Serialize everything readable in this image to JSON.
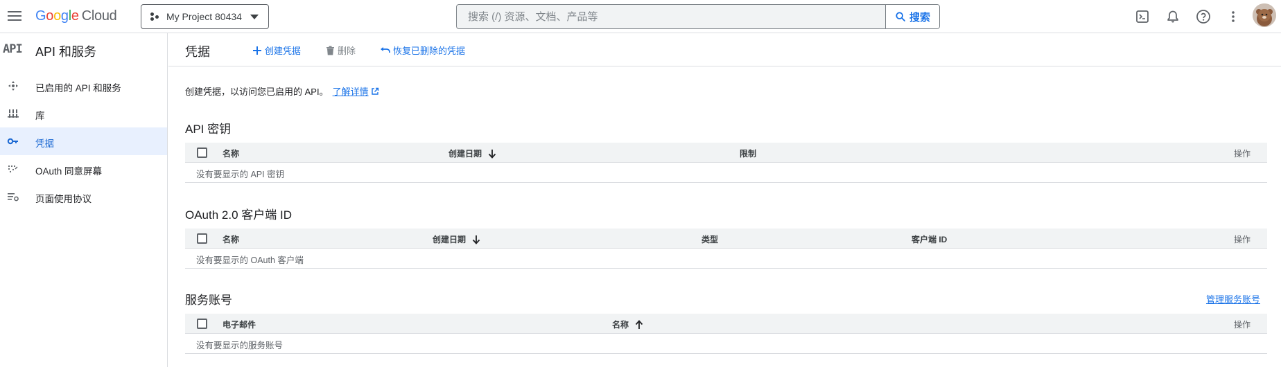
{
  "topbar": {
    "logo": {
      "g": "G",
      "o1": "o",
      "o2": "o",
      "g2": "g",
      "l": "l",
      "e": "e",
      "cloud": "Cloud"
    },
    "project_name": "My Project 80434",
    "search_placeholder": "搜索 (/) 资源、文档、产品等",
    "search_button": "搜索",
    "icons": [
      "terminal-icon",
      "bell-icon",
      "help-icon",
      "more-vert-icon",
      "avatar"
    ]
  },
  "sidebar": {
    "logo_text": "API",
    "title": "API 和服务",
    "items": [
      {
        "label": "已启用的 API 和服务",
        "icon": "enabled-apis-icon",
        "active": false
      },
      {
        "label": "库",
        "icon": "library-icon",
        "active": false
      },
      {
        "label": "凭据",
        "icon": "key-icon",
        "active": true
      },
      {
        "label": "OAuth 同意屏幕",
        "icon": "oauth-consent-icon",
        "active": false
      },
      {
        "label": "页面使用协议",
        "icon": "page-agreements-icon",
        "active": false
      }
    ]
  },
  "main": {
    "title": "凭据",
    "actions": {
      "create": "创建凭据",
      "delete": "删除",
      "restore": "恢复已删除的凭据"
    },
    "intro": {
      "text": "创建凭据，以访问您已启用的 API。",
      "link": "了解详情"
    },
    "api_keys": {
      "title": "API 密钥",
      "columns": [
        "名称",
        "创建日期",
        "限制",
        "操作"
      ],
      "empty": "没有要显示的 API 密钥"
    },
    "oauth": {
      "title": "OAuth 2.0 客户端 ID",
      "columns": [
        "名称",
        "创建日期",
        "类型",
        "客户端 ID",
        "操作"
      ],
      "empty": "没有要显示的 OAuth 客户端"
    },
    "service_accounts": {
      "title": "服务账号",
      "manage_link": "管理服务账号",
      "columns": [
        "电子邮件",
        "名称",
        "操作"
      ],
      "empty": "没有要显示的服务账号"
    }
  },
  "colors": {
    "accent": "#1a73e8",
    "active_bg": "#e8f0fe",
    "header_bg": "#f1f3f4",
    "border": "#dadce0"
  }
}
